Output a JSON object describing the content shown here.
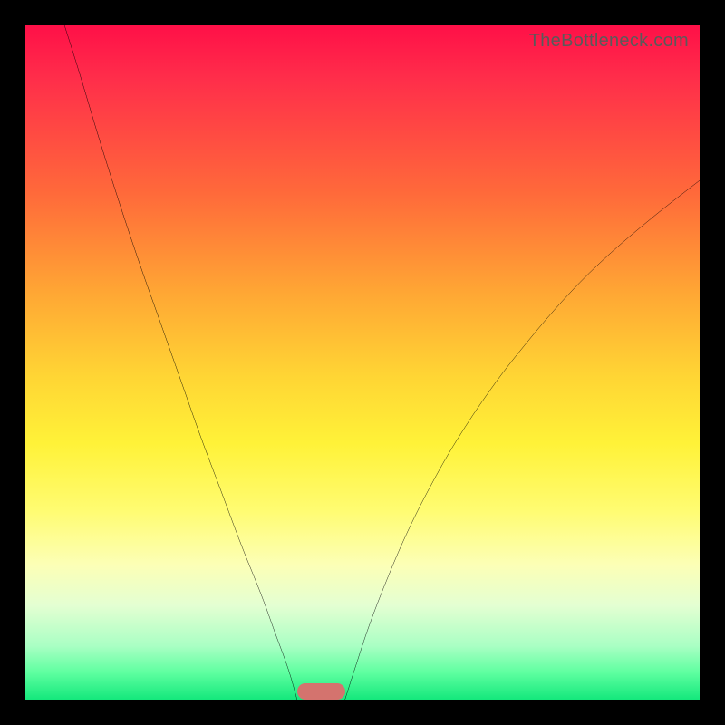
{
  "watermark_text": "TheBottleneck.com",
  "chart_data": {
    "type": "line",
    "title": "",
    "xlabel": "",
    "ylabel": "",
    "xlim": [
      0,
      100
    ],
    "ylim": [
      0,
      100
    ],
    "gradient": {
      "orientation": "vertical",
      "top_color": "#ff1048",
      "mid_color": "#fff238",
      "bottom_color": "#14e87c"
    },
    "series": [
      {
        "name": "left-curve",
        "color": "#000000",
        "width": 3,
        "x": [
          5.8,
          8,
          11,
          14,
          17,
          20,
          23,
          26,
          29,
          32,
          35,
          37,
          39,
          40.3
        ],
        "y": [
          100,
          93,
          83,
          73.5,
          64.5,
          56,
          47.5,
          39,
          31,
          23,
          15.5,
          10,
          4.5,
          0
        ]
      },
      {
        "name": "right-curve",
        "color": "#000000",
        "width": 3,
        "x": [
          47.4,
          49,
          51,
          53.5,
          56.5,
          60,
          64,
          69,
          74,
          80,
          86,
          93,
          100
        ],
        "y": [
          0,
          5,
          11,
          17.5,
          24.5,
          31.5,
          38.5,
          46,
          52.5,
          59.5,
          65.5,
          71.5,
          77
        ]
      }
    ],
    "marker": {
      "x_start": 40.3,
      "x_end": 47.4,
      "color": "#d4736e"
    }
  }
}
